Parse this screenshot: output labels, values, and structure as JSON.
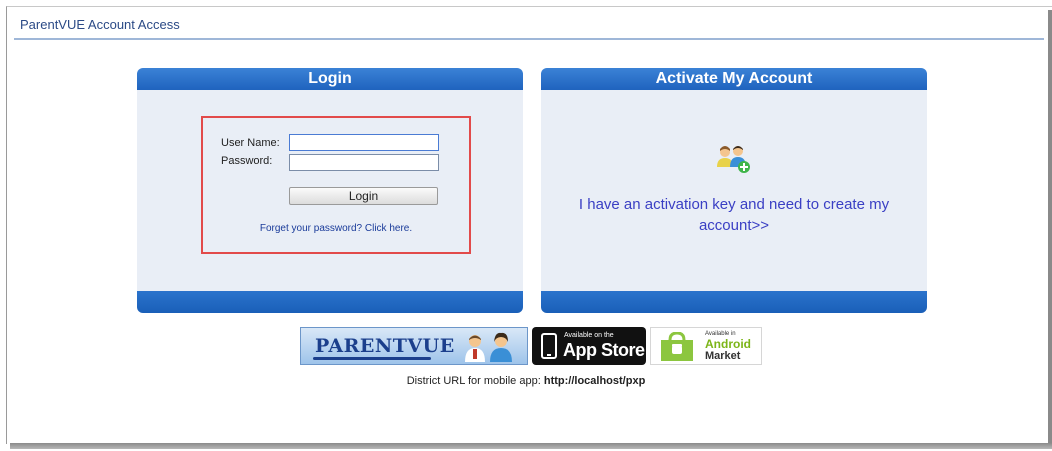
{
  "header": {
    "title": "ParentVUE Account Access"
  },
  "login_panel": {
    "title": "Login",
    "user_label": "User Name:",
    "password_label": "Password:",
    "user_value": "",
    "password_value": "",
    "login_button": "Login",
    "forgot_link": "Forget your password? Click here."
  },
  "activate_panel": {
    "title": "Activate My Account",
    "link_line1": "I have an activation key and need to create my",
    "link_line2": "account>>",
    "icon": "add-users-icon"
  },
  "badges": {
    "parentvue": "PARENTVUE",
    "appstore_small": "Available on the",
    "appstore_big": "App Store",
    "android_small": "Available in",
    "android_big": "Android",
    "android_market": "Market"
  },
  "footer": {
    "district_label": "District URL for mobile app:",
    "district_url": "http://localhost/pxp"
  },
  "colors": {
    "panel_header": "#2a73cc",
    "panel_body": "#e9eef6",
    "highlight_border": "#e24a4a",
    "link": "#3a3fc4"
  }
}
